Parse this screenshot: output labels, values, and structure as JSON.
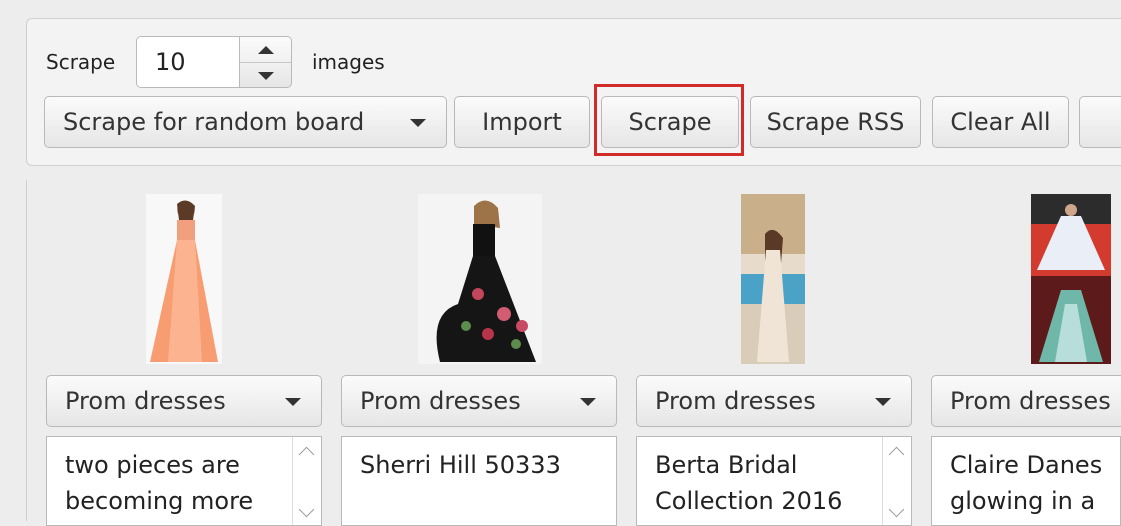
{
  "toolbar": {
    "scrape_label": "Scrape",
    "count_value": "10",
    "images_label": "images",
    "board_select": "Scrape for random board",
    "import_button": "Import",
    "scrape_button": "Scrape",
    "scrape_rss_button": "Scrape RSS",
    "clear_all_button": "Clear All"
  },
  "cards": [
    {
      "board": "Prom dresses",
      "description": "two pieces are becoming more",
      "has_scroll": true
    },
    {
      "board": "Prom dresses",
      "description": "Sherri Hill 50333",
      "has_scroll": false
    },
    {
      "board": "Prom dresses",
      "description": "Berta Bridal Collection 2016",
      "has_scroll": true
    },
    {
      "board": "Prom dresses",
      "description": "Claire Danes glowing in a",
      "has_scroll": false
    }
  ],
  "colors": {
    "highlight": "#d12a2a"
  }
}
